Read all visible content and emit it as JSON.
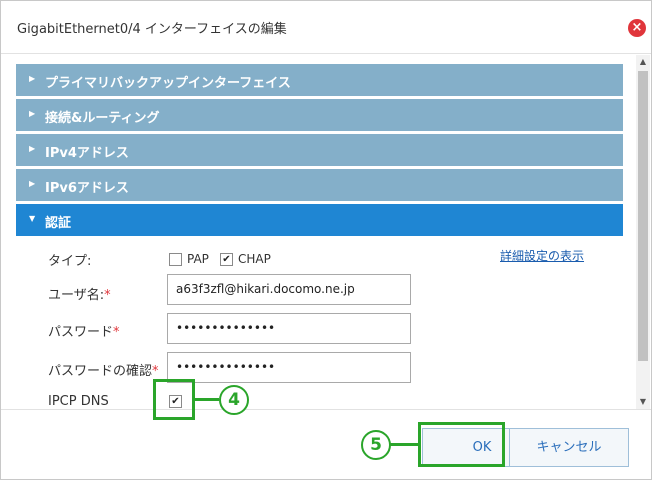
{
  "dialog": {
    "title": "GigabitEthernet0/4 インターフェイスの編集",
    "close_icon": "×"
  },
  "sections": [
    {
      "label": "プライマリバックアップインターフェイス",
      "arrow": "▶"
    },
    {
      "label": "接続&ルーティング",
      "arrow": "▶"
    },
    {
      "label": "IPv4アドレス",
      "arrow": "▶"
    },
    {
      "label": "IPv6アドレス",
      "arrow": "▶"
    },
    {
      "label": "認証",
      "arrow": "▼"
    }
  ],
  "auth": {
    "type_label": "タイプ:",
    "pap_label": "PAP",
    "pap_checked": false,
    "chap_label": "CHAP",
    "chap_checked": true,
    "advanced_link": "詳細設定の表示",
    "username_label": "ユーザ名:",
    "username_value": "a63f3zfl@hikari.docomo.ne.jp",
    "password_label": "パスワード",
    "password_value": "••••••••••••••",
    "password_confirm_label": "パスワードの確認",
    "password_confirm_value": "••••••••••••••",
    "ipcp_dns_label": "IPCP DNS",
    "ipcp_dns_checked": true,
    "required_mark": "*",
    "check_glyph": "✔"
  },
  "buttons": {
    "ok": "OK",
    "cancel": "キャンセル"
  },
  "annotations": {
    "step4": "4",
    "step5": "5",
    "color": "#2aa52a"
  },
  "colors": {
    "section_collapsed": "#84afc9",
    "section_active": "#1f86d3",
    "close": "#e0353b"
  }
}
